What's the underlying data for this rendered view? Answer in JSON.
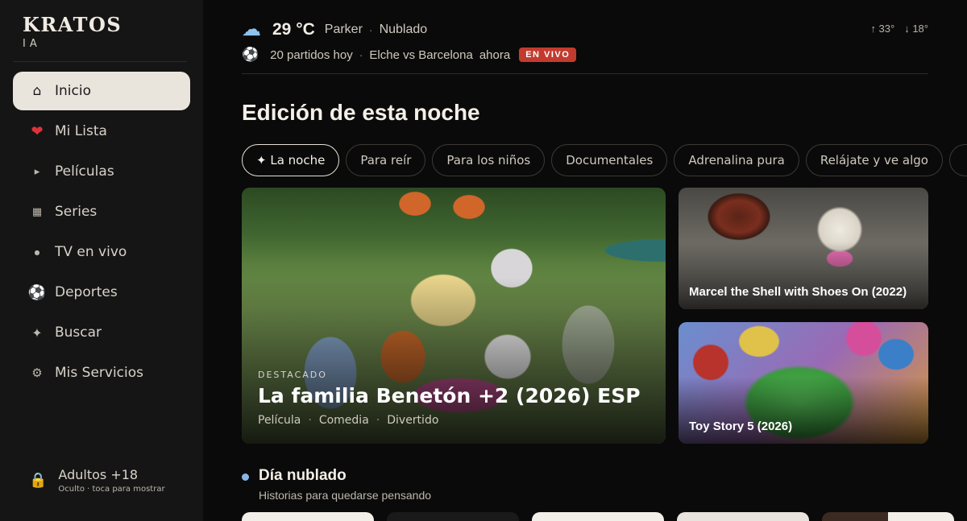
{
  "brand": {
    "name": "KRATOS",
    "sub": "IA"
  },
  "nav": [
    {
      "label": "Inicio",
      "icon": "home-icon",
      "glyph": "⌂",
      "active": true
    },
    {
      "label": "Mi Lista",
      "icon": "heart-icon",
      "glyph": "❤"
    },
    {
      "label": "Películas",
      "icon": "play-icon",
      "glyph": "▸"
    },
    {
      "label": "Series",
      "icon": "grid-icon",
      "glyph": "▦"
    },
    {
      "label": "TV en vivo",
      "icon": "dot-icon",
      "glyph": "●"
    },
    {
      "label": "Deportes",
      "icon": "soccer-ball-icon",
      "glyph": "⚽"
    },
    {
      "label": "Buscar",
      "icon": "sparkle-icon",
      "glyph": "✦"
    },
    {
      "label": "Mis Servicios",
      "icon": "gear-icon",
      "glyph": "⚙"
    }
  ],
  "adult": {
    "title": "Adultos +18",
    "sub": "Oculto · toca para mostrar",
    "icon": "lock-icon"
  },
  "weather": {
    "temp": "29 °C",
    "city": "Parker",
    "separator": "·",
    "condition": "Nublado",
    "high": "↑ 33°",
    "low": "↓ 18°",
    "icon": "cloud-icon"
  },
  "sports": {
    "count": "20 partidos hoy",
    "separator": "·",
    "match": "Elche vs Barcelona",
    "time": "ahora",
    "live": "EN VIVO",
    "icon": "soccer-ball-icon"
  },
  "heading": "Edición de esta noche",
  "chips": [
    "✦ La noche",
    "Para reír",
    "Para los niños",
    "Documentales",
    "Adrenalina pura",
    "Relájate y ve algo",
    ""
  ],
  "featured": {
    "eyebrow": "DESTACADO",
    "title": "La familia Benetón +2 (2026) ESP",
    "meta": [
      "Película",
      "Comedia",
      "Divertido"
    ],
    "meta_sep": "·"
  },
  "tiles": [
    {
      "title": "Marcel the Shell with Shoes On (2022)"
    },
    {
      "title": "Toy Story 5 (2026)"
    }
  ],
  "section": {
    "title": "Día nublado",
    "sub": "Historias para quedarse pensando"
  },
  "colors": {
    "accent_live": "#c23b2f",
    "active_nav_bg": "#eae5dc",
    "section_dot": "#8ab4e6",
    "cloud": "#8fc3ee"
  }
}
